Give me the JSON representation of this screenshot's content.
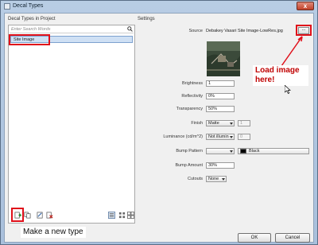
{
  "window": {
    "title": "Decal Types",
    "close_glyph": "x"
  },
  "left": {
    "section_label": "Decal Types in Project",
    "search_placeholder": "Enter Search Words",
    "items": [
      {
        "label": "Site Image",
        "selected": true
      }
    ],
    "toolbar_icons": [
      "new-type-icon",
      "duplicate-icon",
      "rename-icon",
      "delete-icon"
    ],
    "view_icons": [
      "list-view-icon",
      "small-thumbnails-icon",
      "large-thumbnails-icon"
    ]
  },
  "settings": {
    "section_label": "Settings",
    "source_label": "Source",
    "source_value": "Debakey Vasari Site Image-LowRes.jpg",
    "browse_label": "...",
    "brightness_label": "Brightness",
    "brightness_value": "1",
    "reflectivity_label": "Reflectivity",
    "reflectivity_value": "0%",
    "transparency_label": "Transparency",
    "transparency_value": "50%",
    "finish_label": "Finish",
    "finish_value": "Matte",
    "finish_extra": "1",
    "luminance_label": "Luminance (cd/m^2)",
    "luminance_value": "Not illumin",
    "luminance_extra": "0",
    "bump_pattern_label": "Bump Pattern",
    "bump_pattern_value": "",
    "bump_color_label": "Black",
    "bump_amount_label": "Bump Amount",
    "bump_amount_value": "30%",
    "cutouts_label": "Cutouts",
    "cutouts_value": "None"
  },
  "buttons": {
    "ok": "OK",
    "cancel": "Cancel"
  },
  "annotations": {
    "load_image": "Load image here!",
    "make_type": "Make a new type"
  },
  "colors": {
    "highlight": "#e0101a",
    "annotation_text": "#c00000"
  }
}
